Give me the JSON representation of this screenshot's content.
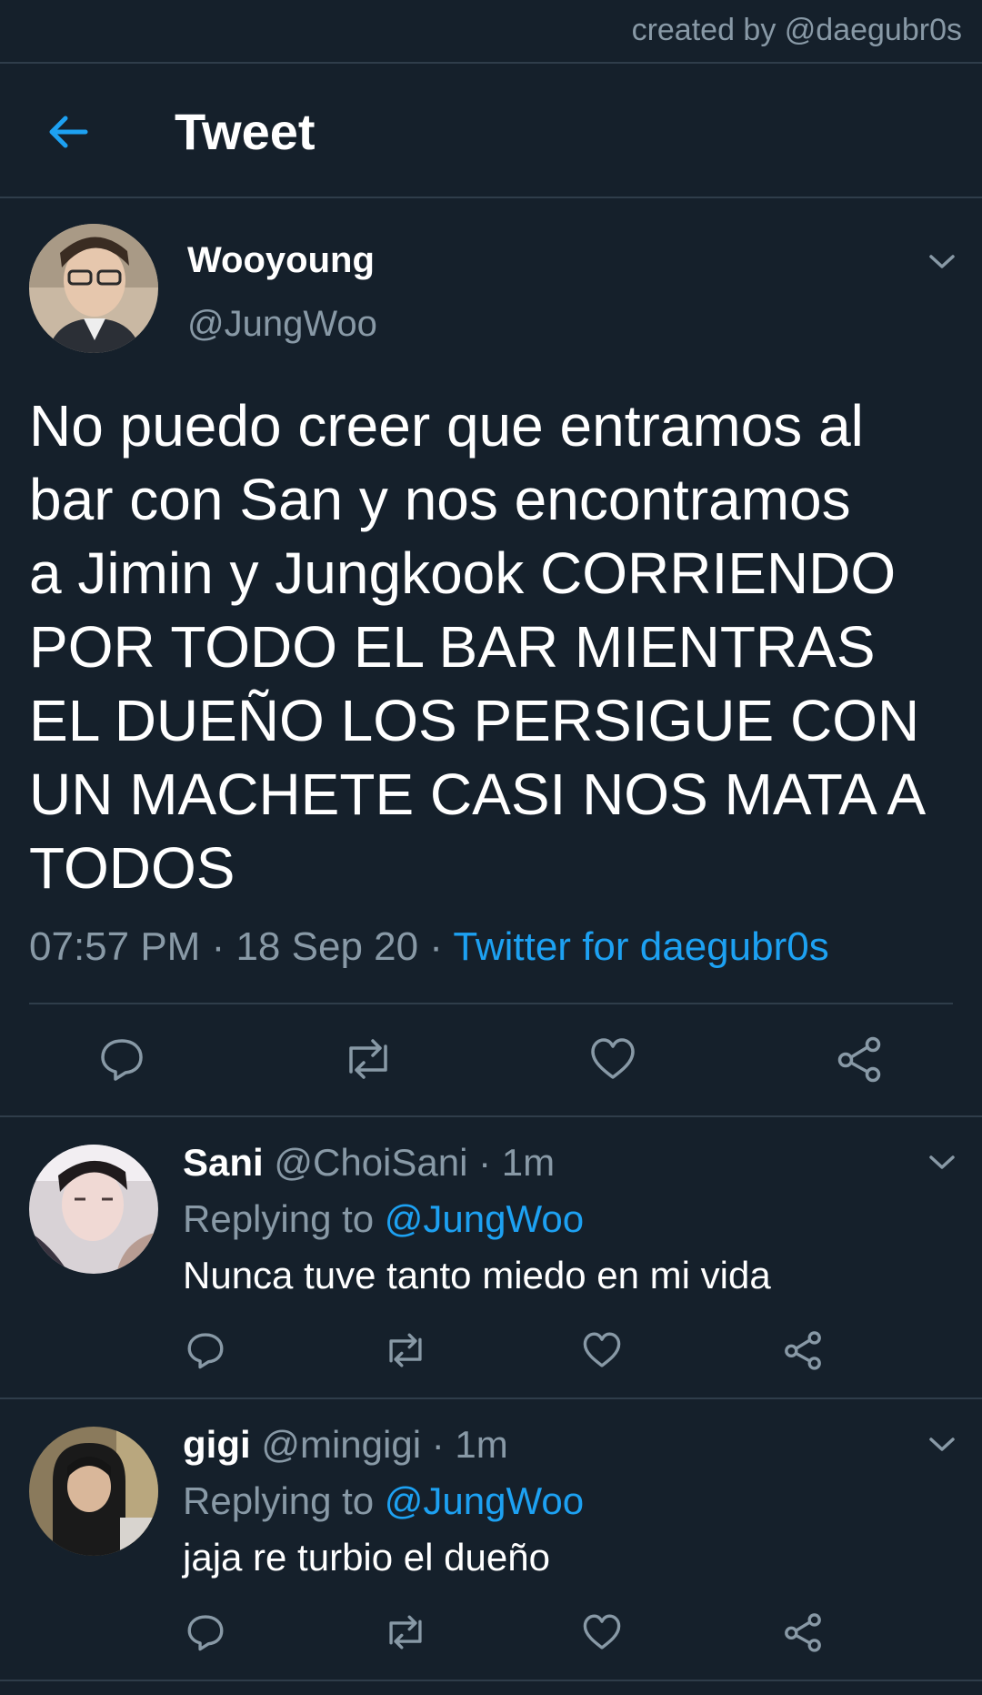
{
  "credit": "created by @daegubr0s",
  "header": {
    "title": "Tweet"
  },
  "tweet": {
    "author_name": "Wooyoung",
    "author_handle": "@JungWoo",
    "text": "No puedo creer que entramos al\nbar con San y nos encontramos\na Jimin y Jungkook CORRIENDO\nPOR TODO EL BAR MIENTRAS\nEL DUEÑO LOS PERSIGUE CON\nUN MACHETE CASI NOS MATA A\nTODOS",
    "time": "07:57 PM",
    "sep1": " · ",
    "date": "18 Sep 20",
    "sep2": " · ",
    "source": "Twitter for daegubr0s",
    "actions": [
      "reply-icon",
      "retweet-icon",
      "like-icon",
      "share-icon"
    ]
  },
  "replies": [
    {
      "name": "Sani",
      "handle": "@ChoiSani",
      "time_sep": " · ",
      "time": "1m",
      "replying_prefix": "Replying to ",
      "replying_to": "@JungWoo",
      "text": "Nunca tuve tanto miedo en mi vida"
    },
    {
      "name": "gigi",
      "handle": "@mingigi",
      "time_sep": " · ",
      "time": "1m",
      "replying_prefix": "Replying to ",
      "replying_to": "@JungWoo",
      "text": "jaja re turbio el dueño"
    }
  ],
  "colors": {
    "background": "#15202b",
    "accent": "#1da1f2",
    "secondary_text": "#8899a6",
    "divider": "#2f3d4a"
  }
}
